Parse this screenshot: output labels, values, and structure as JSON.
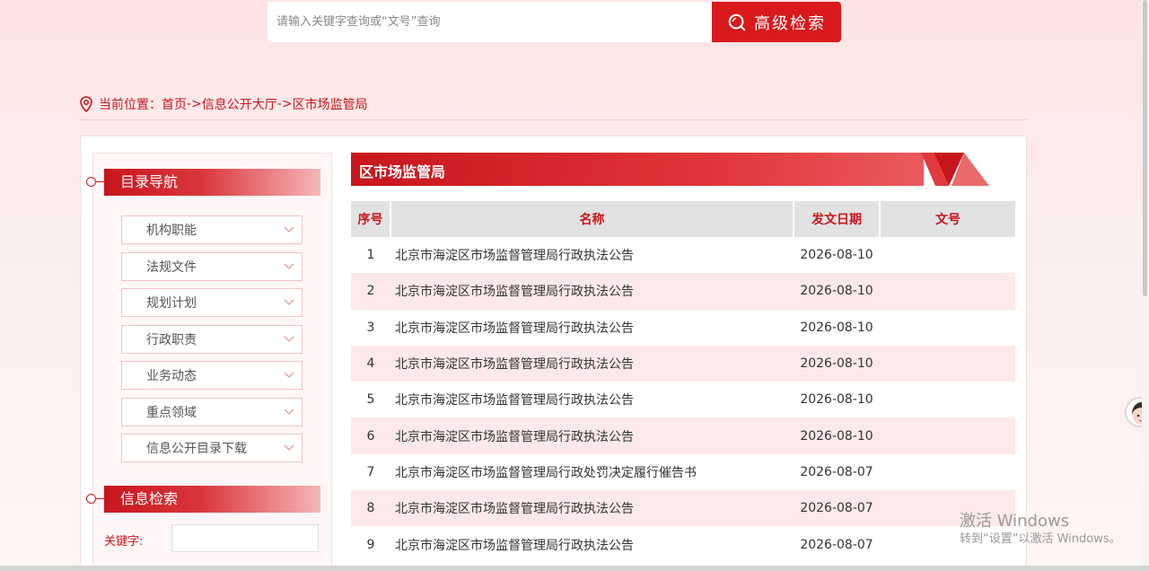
{
  "search": {
    "placeholder": "请输入关键字查询或“文号”查询",
    "advanced_label": "高级检索"
  },
  "breadcrumb": {
    "prefix": "当前位置：",
    "items": [
      "首页",
      "->",
      "信息公开大厅",
      "->",
      "区市场监管局"
    ]
  },
  "sidebar": {
    "nav_title": "目录导航",
    "items": [
      {
        "label": "机构职能"
      },
      {
        "label": "法规文件"
      },
      {
        "label": "规划计划"
      },
      {
        "label": "行政职责"
      },
      {
        "label": "业务动态"
      },
      {
        "label": "重点领域"
      },
      {
        "label": "信息公开目录下载"
      }
    ],
    "search_title": "信息检索",
    "keyword_label": "关键字:"
  },
  "content": {
    "title": "区市场监管局",
    "columns": [
      "序号",
      "名称",
      "发文日期",
      "文号"
    ],
    "rows": [
      {
        "no": "1",
        "name": "北京市海淀区市场监督管理局行政执法公告",
        "date": "2026-08-10",
        "doc": ""
      },
      {
        "no": "2",
        "name": "北京市海淀区市场监督管理局行政执法公告",
        "date": "2026-08-10",
        "doc": ""
      },
      {
        "no": "3",
        "name": "北京市海淀区市场监督管理局行政执法公告",
        "date": "2026-08-10",
        "doc": ""
      },
      {
        "no": "4",
        "name": "北京市海淀区市场监督管理局行政执法公告",
        "date": "2026-08-10",
        "doc": ""
      },
      {
        "no": "5",
        "name": "北京市海淀区市场监督管理局行政执法公告",
        "date": "2026-08-10",
        "doc": ""
      },
      {
        "no": "6",
        "name": "北京市海淀区市场监督管理局行政执法公告",
        "date": "2026-08-10",
        "doc": ""
      },
      {
        "no": "7",
        "name": "北京市海淀区市场监督管理局行政处罚决定履行催告书",
        "date": "2026-08-07",
        "doc": ""
      },
      {
        "no": "8",
        "name": "北京市海淀区市场监督管理局行政执法公告",
        "date": "2026-08-07",
        "doc": ""
      },
      {
        "no": "9",
        "name": "北京市海淀区市场监督管理局行政执法公告",
        "date": "2026-08-07",
        "doc": ""
      }
    ]
  },
  "watermark": {
    "line1": "激活 Windows",
    "line2": "转到“设置”以激活 Windows。"
  },
  "colors": {
    "brand_red": "#d9191c",
    "row_stripe": "#fde9e9"
  }
}
